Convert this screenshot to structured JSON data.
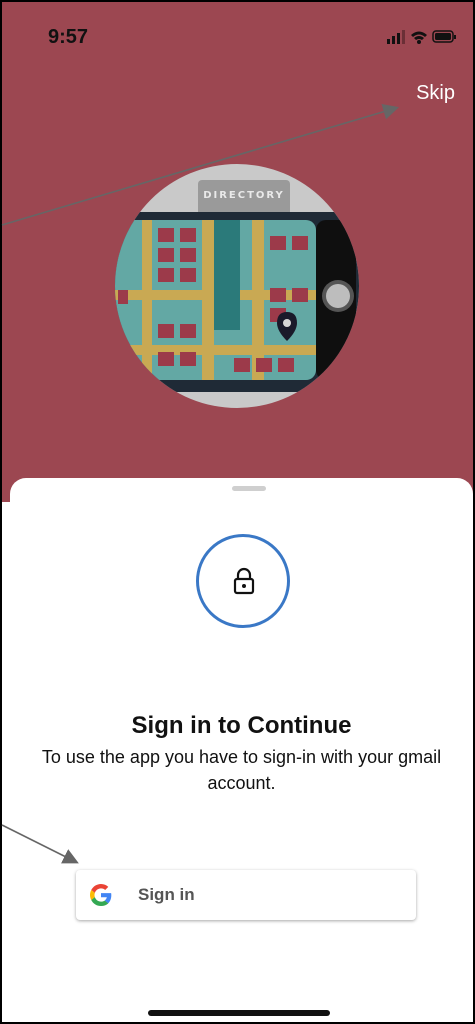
{
  "status_bar": {
    "time": "9:57"
  },
  "header": {
    "skip_label": "Skip"
  },
  "illustration": {
    "sign_text": "DIRECTORY"
  },
  "sheet": {
    "title": "Sign in to Continue",
    "subtitle": "To use the app you have to sign-in with your gmail account.",
    "signin_label": "Sign in"
  },
  "colors": {
    "hero_background": "#9c4751",
    "accent_blue": "#3a78c6"
  }
}
